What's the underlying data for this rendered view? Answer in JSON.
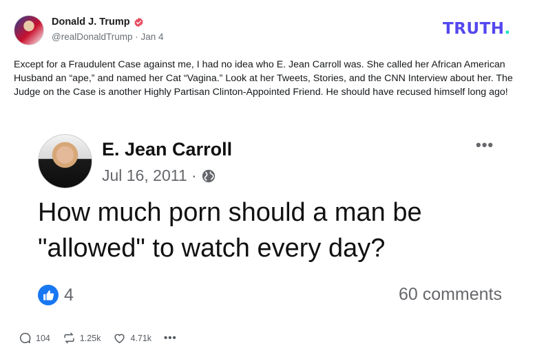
{
  "post": {
    "author_name": "Donald J. Trump",
    "handle": "@realDonaldTrump · Jan 4",
    "text": "Except for a Fraudulent Case against me, I had no idea who E. Jean Carroll was. She called her African American Husband an “ape,” and named her Cat “Vagina.” Look at her Tweets, Stories, and the CNN Interview about her. The Judge on the Case is another Highly Partisan Clinton-Appointed Friend. He should have recused himself long ago!"
  },
  "brand": {
    "logo_text": "TRUTH",
    "logo_dot": ".",
    "color": "#5448ee",
    "dot_color": "#17e2c7"
  },
  "embed": {
    "name": "E. Jean Carroll",
    "date": "Jul 16, 2011 ·",
    "text": "How much porn should a man be \"allowed\" to watch every day?",
    "likes": "4",
    "comments": "60 comments",
    "more": "•••"
  },
  "actions": {
    "replies": "104",
    "retruths": "1.25k",
    "likes": "4.71k",
    "more": "•••"
  },
  "icons": [
    "verified-badge-icon",
    "globe-icon",
    "like-thumb-icon",
    "reply-icon",
    "retruth-icon",
    "heart-icon",
    "more-icon"
  ]
}
